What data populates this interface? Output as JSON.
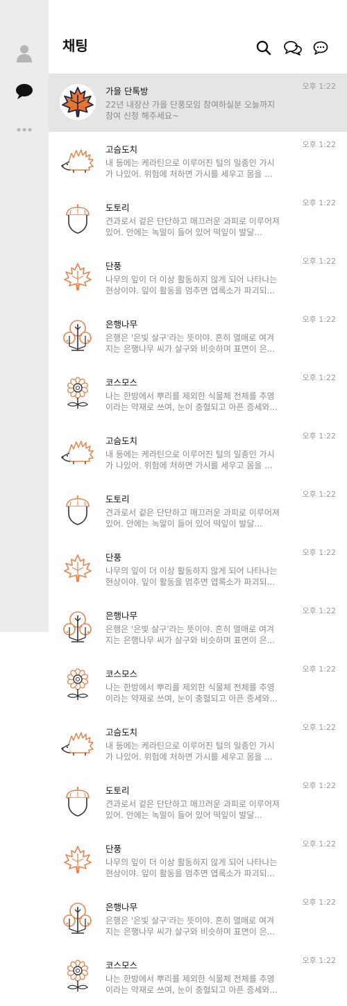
{
  "header": {
    "title": "채팅"
  },
  "colors": {
    "accent": "#e8824a",
    "sidebar_bg": "#ececec",
    "active_row_bg": "#e5e5e5",
    "icon_dark": "#222222"
  },
  "sidebar": {
    "items": [
      {
        "icon": "person-icon"
      },
      {
        "icon": "chat-bubble-icon"
      },
      {
        "icon": "more-icon"
      }
    ]
  },
  "header_icons": [
    "search-icon",
    "open-chat-icon",
    "new-chat-icon"
  ],
  "chats": [
    {
      "name": "가을 단톡방",
      "time": "오후 1:22",
      "preview": "22년 내장산 가을 단풍모임 참여하실분 오늘까지 참여 신청 해주세요~",
      "icon": "maple-leaf-icon"
    },
    {
      "name": "고슴도치",
      "time": "오후 1:22",
      "preview": "내 등에는 케라틴으로 이루어진 털의 일종인 가시가 나있어. 위험에 처하면 가시를 세우고 몸을 ...",
      "icon": "hedgehog-icon"
    },
    {
      "name": "도토리",
      "time": "오후 1:22",
      "preview": "견과로서 겉은 단단하고 매끄러운 과피로 이루어져 있어. 안에는 녹말이 들어 있어 떡잎이 발달...",
      "icon": "acorn-icon"
    },
    {
      "name": "단풍",
      "time": "오후 1:22",
      "preview": "나무의 잎이 더 이상 활동하지 않게 되어 나타나는 현상이야. 잎이 활동을 멈추면 엽록소가 파괴되...",
      "icon": "maple-leaf-icon"
    },
    {
      "name": "은행나무",
      "time": "오후 1:22",
      "preview": "은행은 '은빛 살구'라는 뜻이야. 흔히 열매로 여겨지는 은행나무 씨가 살구와 비슷하며 표면이 은...",
      "icon": "ginkgo-tree-icon"
    },
    {
      "name": "코스모스",
      "time": "오후 1:22",
      "preview": "나는 한방에서 뿌리를 제외한 식물체 전체를 추영이라는 약재로 쓰여, 눈이 충혈되고 아픈 증세와...",
      "icon": "cosmos-flower-icon"
    },
    {
      "name": "고슴도치",
      "time": "오후 1:22",
      "preview": "내 등에는 케라틴으로 이루어진 털의 일종인 가시가 나있어. 위험에 처하면 가시를 세우고 몸을 ...",
      "icon": "hedgehog-icon"
    },
    {
      "name": "도토리",
      "time": "오후 1:22",
      "preview": "견과로서 겉은 단단하고 매끄러운 과피로 이루어져 있어. 안에는 녹말이 들어 있어 떡잎이 발달...",
      "icon": "acorn-icon"
    },
    {
      "name": "단풍",
      "time": "오후 1:22",
      "preview": "나무의 잎이 더 이상 활동하지 않게 되어 나타나는 현상이야. 잎이 활동을 멈추면 엽록소가 파괴되...",
      "icon": "maple-leaf-icon"
    },
    {
      "name": "은행나무",
      "time": "오후 1:22",
      "preview": "은행은 '은빛 살구'라는 뜻이야. 흔히 열매로 여겨지는 은행나무 씨가 살구와 비슷하며 표면이 은...",
      "icon": "ginkgo-tree-icon"
    },
    {
      "name": "코스모스",
      "time": "오후 1:22",
      "preview": "나는 한방에서 뿌리를 제외한 식물체 전체를 추영이라는 약재로 쓰여, 눈이 충혈되고 아픈 증세와...",
      "icon": "cosmos-flower-icon"
    },
    {
      "name": "고슴도치",
      "time": "오후 1:22",
      "preview": "내 등에는 케라틴으로 이루어진 털의 일종인 가시가 나있어. 위험에 처하면 가시를 세우고 몸을 ...",
      "icon": "hedgehog-icon"
    },
    {
      "name": "도토리",
      "time": "오후 1:22",
      "preview": "견과로서 겉은 단단하고 매끄러운 과피로 이루어져 있어. 안에는 녹말이 들어 있어 떡잎이 발달...",
      "icon": "acorn-icon"
    },
    {
      "name": "단풍",
      "time": "오후 1:22",
      "preview": "나무의 잎이 더 이상 활동하지 않게 되어 나타나는 현상이야. 잎이 활동을 멈추면 엽록소가 파괴되...",
      "icon": "maple-leaf-icon"
    },
    {
      "name": "은행나무",
      "time": "오후 1:22",
      "preview": "은행은 '은빛 살구'라는 뜻이야. 흔히 열매로 여겨지는 은행나무 씨가 살구와 비슷하며 표면이 은...",
      "icon": "ginkgo-tree-icon"
    },
    {
      "name": "코스모스",
      "time": "오후 1:22",
      "preview": "나는 한방에서 뿌리를 제외한 식물체 전체를 추영이라는 약재로 쓰여, 눈이 충혈되고 아픈 증세와...",
      "icon": "cosmos-flower-icon"
    }
  ]
}
